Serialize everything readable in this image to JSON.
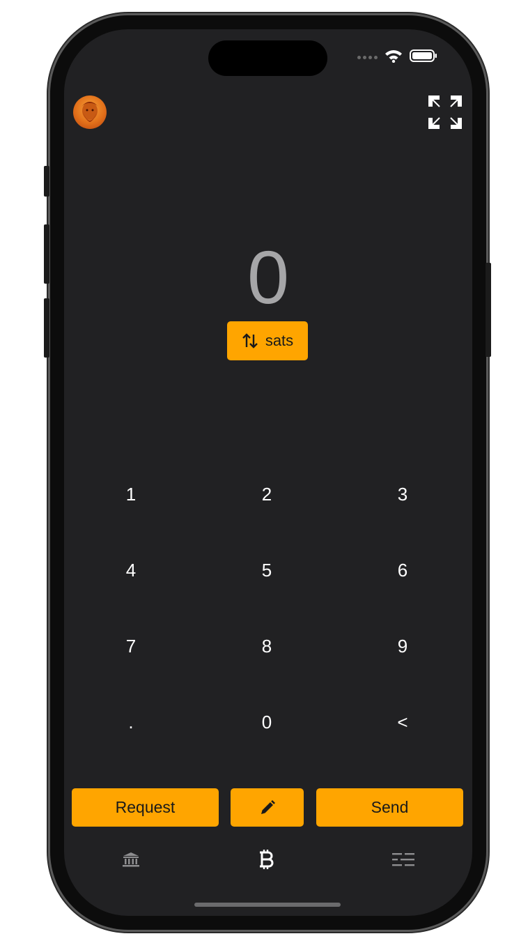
{
  "status_bar": {
    "wifi_icon": "wifi-icon",
    "battery_icon": "battery-icon"
  },
  "header": {
    "avatar_icon": "profile-avatar",
    "scan_icon": "scan-frame-icon"
  },
  "amount": {
    "value": "0",
    "unit_label": "sats",
    "toggle_icon": "swap-arrows-icon"
  },
  "keypad": {
    "keys": [
      "1",
      "2",
      "3",
      "4",
      "5",
      "6",
      "7",
      "8",
      "9",
      ".",
      "0",
      "<"
    ]
  },
  "actions": {
    "request_label": "Request",
    "edit_icon": "pencil-icon",
    "send_label": "Send"
  },
  "tab_bar": {
    "tabs": [
      {
        "icon": "bank-icon",
        "active": false
      },
      {
        "icon": "bitcoin-icon",
        "active": true
      },
      {
        "icon": "transactions-list-icon",
        "active": false
      }
    ]
  },
  "colors": {
    "accent": "#FFA500",
    "background": "#212123",
    "amount_text": "#A6A6A8",
    "inactive_icon": "#8E8E90"
  }
}
